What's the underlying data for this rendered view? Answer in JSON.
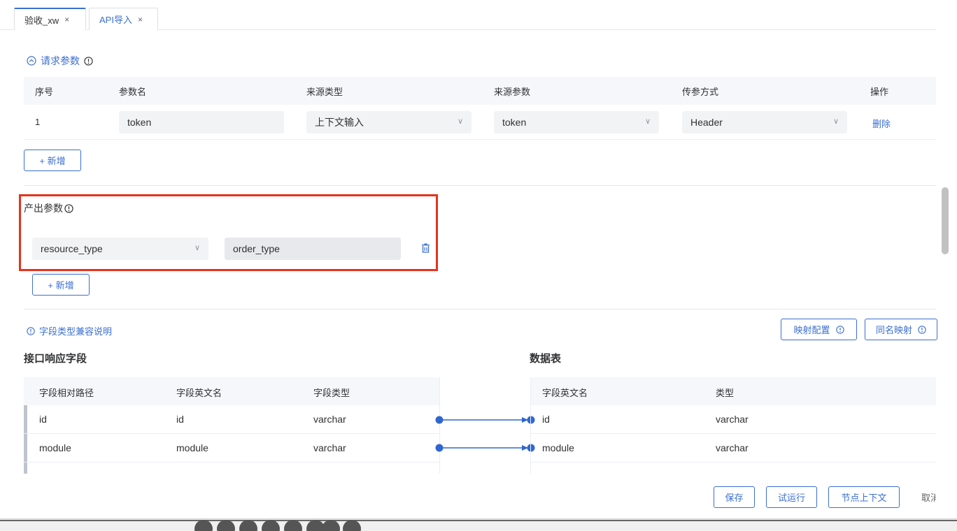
{
  "tabs": [
    {
      "label": "验收_xw",
      "close": "×"
    },
    {
      "label": "API导入",
      "close": "×"
    }
  ],
  "request_params": {
    "title": "请求参数",
    "headers": [
      "序号",
      "参数名",
      "来源类型",
      "来源参数",
      "传参方式",
      "操作"
    ],
    "rows": [
      {
        "index": "1",
        "name": "token",
        "source_type": "上下文输入",
        "source_param": "token",
        "method": "Header",
        "action": "删除"
      }
    ],
    "add_label": "+ 新增"
  },
  "output_params": {
    "title": "产出参数",
    "row": {
      "select": "resource_type",
      "value": "order_type"
    },
    "add_label": "+ 新增"
  },
  "compat_note": "字段类型兼容说明",
  "mapping_buttons": {
    "mapping_config": "映射配置",
    "same_name_mapping": "同名映射"
  },
  "api_fields": {
    "title": "接口响应字段",
    "headers": [
      "字段相对路径",
      "字段英文名",
      "字段类型"
    ],
    "rows": [
      {
        "path": "id",
        "name": "id",
        "type": "varchar"
      },
      {
        "path": "module",
        "name": "module",
        "type": "varchar"
      }
    ]
  },
  "data_table": {
    "title": "数据表",
    "headers": [
      "字段英文名",
      "类型"
    ],
    "rows": [
      {
        "name": "id",
        "type": "varchar"
      },
      {
        "name": "module",
        "type": "varchar"
      }
    ]
  },
  "footer": {
    "save": "保存",
    "trial_run": "试运行",
    "node_context": "节点上下文",
    "cancel": "取消"
  },
  "colors": {
    "accent": "#3b6fd0",
    "highlight": "#e8321c"
  }
}
